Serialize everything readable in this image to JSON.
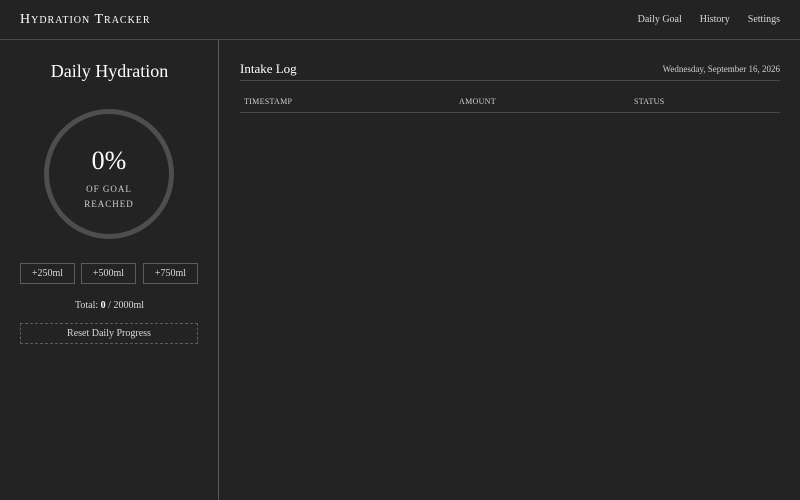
{
  "app": {
    "title": "Hydration Tracker"
  },
  "nav": {
    "items": [
      "Daily Goal",
      "History",
      "Settings"
    ]
  },
  "left_panel": {
    "title": "Daily Hydration",
    "progress": {
      "percent_text": "0%",
      "label_line1": "OF GOAL",
      "label_line2": "REACHED",
      "value_fraction": 0
    },
    "quick_add": [
      "+250ml",
      "+500ml",
      "+750ml"
    ],
    "total": {
      "prefix": "Total:",
      "current": "0",
      "separator": "/",
      "goal": "2000ml"
    },
    "reset_label": "Reset Daily Progress"
  },
  "main": {
    "title": "Intake Log",
    "date": "Wednesday, September 16, 2026",
    "columns": [
      "TIMESTAMP",
      "AMOUNT",
      "STATUS"
    ],
    "rows": []
  },
  "colors": {
    "background": "#232323",
    "ring": "#4e4e4e",
    "divider": "#4a4a4a",
    "text": "#d8d8d8",
    "heading": "#ffffff"
  }
}
